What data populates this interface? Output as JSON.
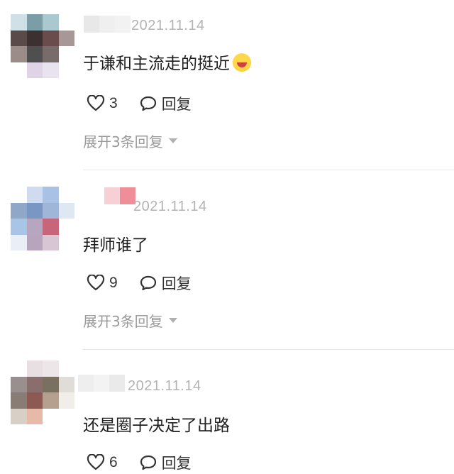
{
  "comments": [
    {
      "date": "2021.11.14",
      "text": "于谦和主流走的挺近",
      "emoji": "laughing-tears-emoji",
      "likes": "3",
      "reply_label": "回复",
      "expand_label": "展开3条回复",
      "avatar_colors": [
        "#cfe0e6",
        "#7b9ea6",
        "#a9c9cf",
        "#ffffff",
        "#5a4a4a",
        "#3d3030",
        "#6b4c4c",
        "#a79797",
        "#9c8c88",
        "#4f4f4f",
        "#776c6a",
        "#ffffff",
        "#ffffff",
        "#dfd3e6",
        "#e8e3ef",
        "#ffffff"
      ],
      "name_colors": [
        "#e8e8e8",
        "#efefef",
        "#f2f2f2"
      ]
    },
    {
      "date": "2021.11.14",
      "text": "拜师谁了",
      "likes": "9",
      "reply_label": "回复",
      "expand_label": "展开3条回复",
      "avatar_colors": [
        "#ffffff",
        "#cfdcef",
        "#a9c1e4",
        "#ffffff",
        "#8fa8c8",
        "#7a97c4",
        "#9fb6d9",
        "#dfe7f3",
        "#a8c4e6",
        "#b7a6c0",
        "#c7667a",
        "#ffffff",
        "#e9eef7",
        "#b7a4bd",
        "#d8c6d3",
        "#ffffff"
      ],
      "name_colors": [
        "#ffffff",
        "#f6d0d4",
        "#ef8e98"
      ]
    },
    {
      "date": "2021.11.14",
      "text": "还是圈子决定了出路",
      "likes": "6",
      "reply_label": "回复",
      "avatar_colors": [
        "#ffffff",
        "#e7dfe2",
        "#ece6e8",
        "#ffffff",
        "#9a8f8f",
        "#8a6e6e",
        "#7a7060",
        "#e0dcd8",
        "#887c74",
        "#8c5a52",
        "#b5a08f",
        "#f1ede8",
        "#d8cfc6",
        "#e7b9a8",
        "#ffffff",
        "#ffffff"
      ],
      "name_colors": [
        "#eeeeee",
        "#f3f3f3",
        "#eaeaea"
      ]
    }
  ]
}
